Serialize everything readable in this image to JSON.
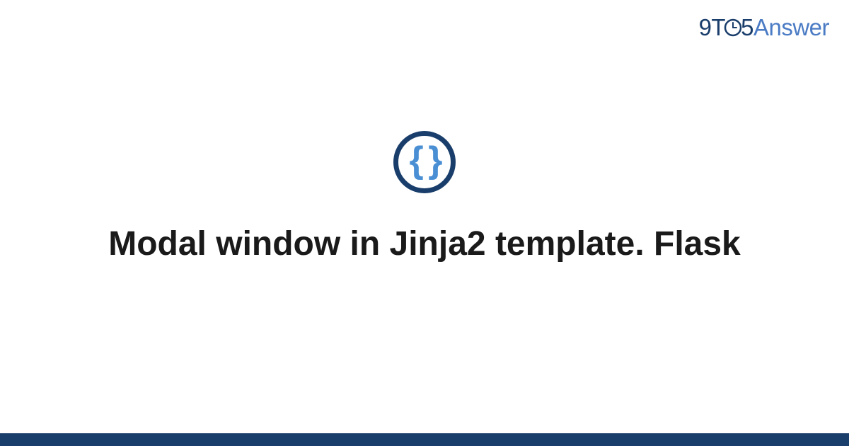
{
  "brand": {
    "part1": "9T",
    "part2": "5",
    "part3": "Answer"
  },
  "icon": {
    "braces": "{ }"
  },
  "title": "Modal window in Jinja2 template. Flask",
  "colors": {
    "brand_dark": "#1a3e6b",
    "brand_light": "#4a7bc4",
    "icon_braces": "#4a8fd4",
    "footer": "#1a3e6b"
  }
}
